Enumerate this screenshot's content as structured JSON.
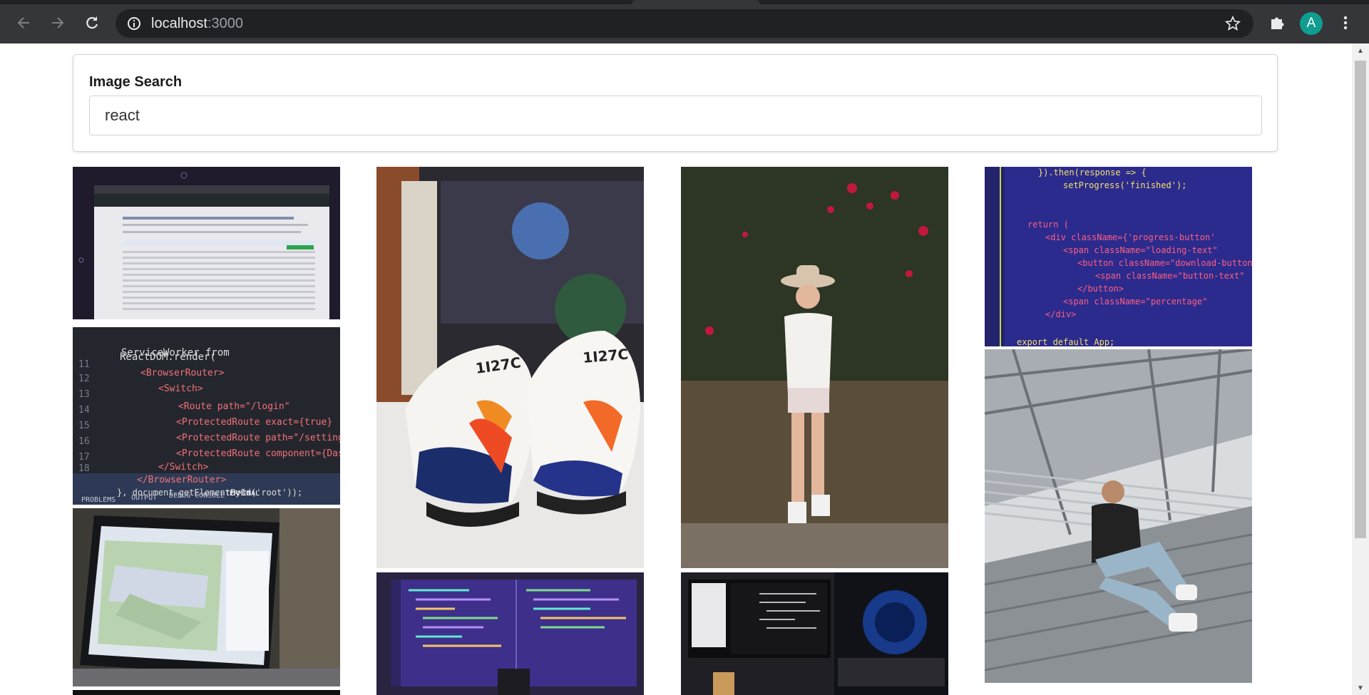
{
  "browser": {
    "url_host": "localhost",
    "url_port": ":3000",
    "avatar_letter": "A"
  },
  "search": {
    "label": "Image Search",
    "value": "react"
  },
  "images": [
    {
      "subject": "GitHub repository page for facebook/react on a laptop screen"
    },
    {
      "subject": "Code editor showing ReactDOM.render with BrowserRouter routes"
    },
    {
      "subject": "Laptop displaying a map application"
    },
    {
      "subject": "Nike React sneakers in front of comic figures"
    },
    {
      "subject": "Monitor with purple code editor"
    },
    {
      "subject": "Woman in hat standing before flowering bush"
    },
    {
      "subject": "Multiple monitors with code and gaming PC"
    },
    {
      "subject": "Colorful JSX code on purple background"
    },
    {
      "subject": "Man sitting on stairs in steel building"
    }
  ],
  "code_text": {
    "editor1_line1": "ReactDOM.render(",
    "editor1_line2": "<BrowserRouter>",
    "editor1_line3": "<Switch>",
    "editor1_line4": "<Route path=\"/login\"",
    "editor1_line5": "<ProtectedRoute exact={true}",
    "editor1_line6": "<ProtectedRoute path=\"/settings\"",
    "editor1_line7": "<ProtectedRoute component={Dashboard}",
    "editor1_line8": "</Switch>",
    "editor1_line9": "</BrowserRouter>",
    "editor1_line10": "}, document.getElementById('root'));",
    "panel_tabs": [
      "PROBLEMS",
      "OUTPUT",
      "DEBUG CONSOLE",
      "TERMINAL"
    ],
    "editor2_line1": "}).then(response => {",
    "editor2_line2": "setProgress('finished');",
    "editor2_line3": "return (",
    "editor2_line4": "<div className={'progress-button'",
    "editor2_line5": "<span className=\"loading-text\"",
    "editor2_line6": "<button className=\"download-button\"",
    "editor2_line7": "<span className=\"button-text\"",
    "editor2_line8": "</button>",
    "editor2_line9": "<span className=\"percentage\"",
    "editor2_line10": "</div>",
    "editor2_line11": "export default App;"
  }
}
